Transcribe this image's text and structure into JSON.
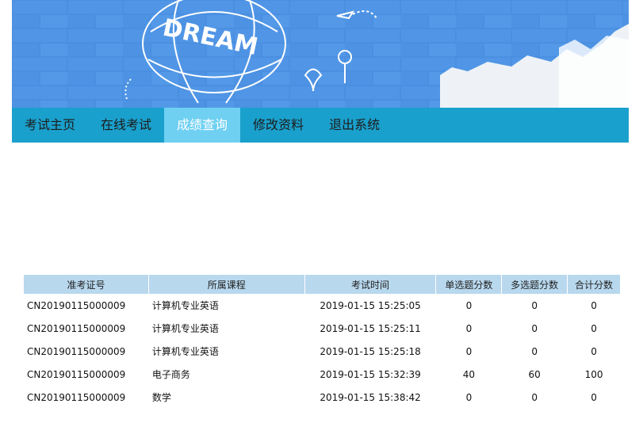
{
  "banner": {
    "title": "DREAM"
  },
  "nav": {
    "items": [
      {
        "label": "考试主页",
        "active": false
      },
      {
        "label": "在线考试",
        "active": false
      },
      {
        "label": "成绩查询",
        "active": true
      },
      {
        "label": "修改资料",
        "active": false
      },
      {
        "label": "退出系统",
        "active": false
      }
    ]
  },
  "table": {
    "headers": [
      "准考证号",
      "所属课程",
      "考试时间",
      "单选题分数",
      "多选题分数",
      "合计分数"
    ],
    "rows": [
      [
        "CN20190115000009",
        "计算机专业英语",
        "2019-01-15 15:25:05",
        "0",
        "0",
        "0"
      ],
      [
        "CN20190115000009",
        "计算机专业英语",
        "2019-01-15 15:25:11",
        "0",
        "0",
        "0"
      ],
      [
        "CN20190115000009",
        "计算机专业英语",
        "2019-01-15 15:25:18",
        "0",
        "0",
        "0"
      ],
      [
        "CN20190115000009",
        "电子商务",
        "2019-01-15 15:32:39",
        "40",
        "60",
        "100"
      ],
      [
        "CN20190115000009",
        "数学",
        "2019-01-15 15:38:42",
        "0",
        "0",
        "0"
      ]
    ]
  },
  "colors": {
    "banner_blue": "#4a90e2",
    "nav_bg": "#1aa0cc",
    "nav_active": "#6fd0f2",
    "header_bg": "#b8d8ee"
  }
}
